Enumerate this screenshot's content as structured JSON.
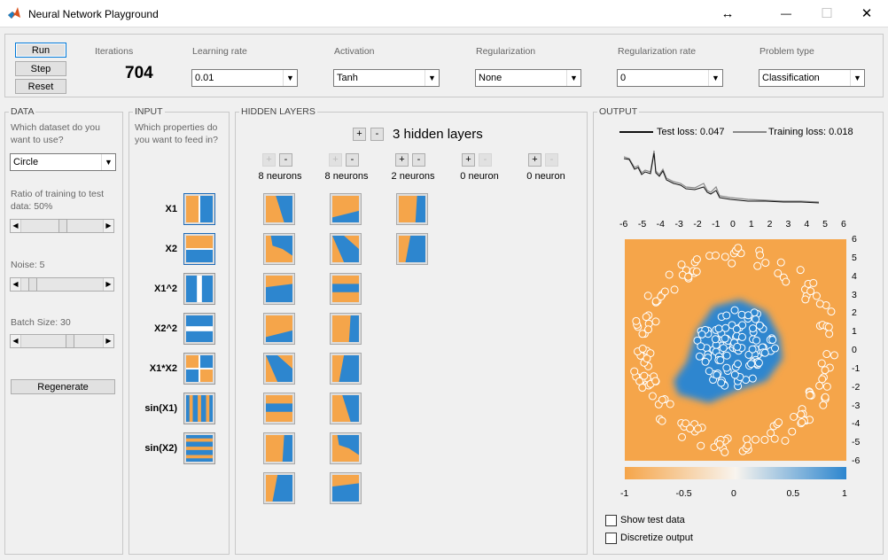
{
  "window": {
    "title": "Neural Network Playground",
    "resize_glyph": "↔",
    "min_glyph": "—",
    "max_glyph": "☐",
    "close_glyph": "✕",
    "icon": "matlab-icon"
  },
  "controls": {
    "run": "Run",
    "step": "Step",
    "reset": "Reset",
    "iterations_label": "Iterations",
    "iterations": "704",
    "lr_label": "Learning rate",
    "lr": "0.01",
    "act_label": "Activation",
    "act": "Tanh",
    "reg_label": "Regularization",
    "reg": "None",
    "regrate_label": "Regularization rate",
    "regrate": "0",
    "ptype_label": "Problem type",
    "ptype": "Classification"
  },
  "data_panel": {
    "title": "DATA",
    "question": "Which dataset do you want to use?",
    "dataset": "Circle",
    "ratio": "Ratio of training to test data: 50%",
    "noise": "Noise:  5",
    "batch": "Batch Size: 30",
    "regenerate": "Regenerate",
    "ratio_value": 0.5,
    "noise_value": 0.1,
    "batch_value": 0.6
  },
  "input_panel": {
    "title": "INPUT",
    "question": "Which properties do you want to feed in?",
    "features": [
      "X1",
      "X2",
      "X1^2",
      "X2^2",
      "X1*X2",
      "sin(X1)",
      "sin(X2)"
    ]
  },
  "hidden_panel": {
    "title": "HIDDEN LAYERS",
    "plus": "+",
    "minus": "-",
    "count_label": "3 hidden layers",
    "layers": [
      "8 neurons",
      "8 neurons",
      "2 neurons",
      "0 neuron",
      "0 neuron"
    ]
  },
  "output_panel": {
    "title": "OUTPUT",
    "test_loss": "Test loss: 0.047",
    "train_loss": "Training loss: 0.018",
    "xticks": [
      "-6",
      "-5",
      "-4",
      "-3",
      "-2",
      "-1",
      "0",
      "1",
      "2",
      "3",
      "4",
      "5",
      "6"
    ],
    "yticks": [
      "6",
      "5",
      "4",
      "3",
      "2",
      "1",
      "0",
      "-1",
      "-2",
      "-3",
      "-4",
      "-5",
      "-6"
    ],
    "cticks": [
      "-1",
      "-0.5",
      "0",
      "0.5",
      "1"
    ],
    "show_test": "Show test data",
    "discretize": "Discretize output"
  },
  "colors": {
    "orange": "#f5a54a",
    "blue": "#2d86cf"
  }
}
